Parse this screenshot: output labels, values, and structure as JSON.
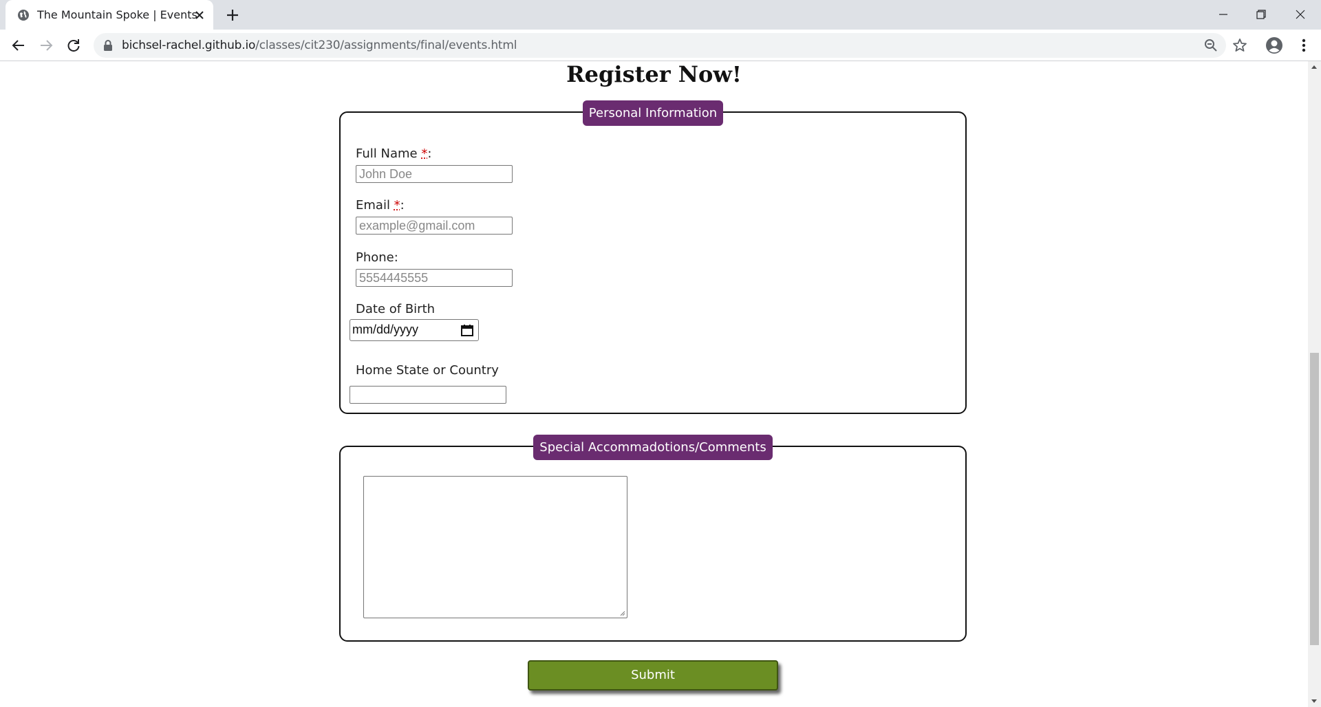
{
  "browser": {
    "tab_title": "The Mountain Spoke | Events",
    "url_host": "bichsel-rachel.github.io",
    "url_path": "/classes/cit230/assignments/final/events.html"
  },
  "page": {
    "heading": "Register Now!",
    "personal": {
      "legend": "Personal Information",
      "full_name_label": "Full Name ",
      "full_name_placeholder": "John Doe",
      "email_label": "Email ",
      "email_placeholder": "example@gmail.com",
      "phone_label": "Phone:",
      "phone_placeholder": "5554445555",
      "dob_label": "Date of Birth",
      "dob_value": "mm/dd/yyyy",
      "home_label": "Home State or Country",
      "required_mark": "*",
      "colon": ":"
    },
    "special": {
      "legend": "Special Accommadotions/Comments"
    },
    "submit_label": "Submit"
  },
  "colors": {
    "legend_bg": "#6a2c70",
    "submit_bg": "#6b8e23",
    "required": "#cc0000"
  },
  "icons": [
    "globe-icon",
    "close-icon",
    "plus-icon",
    "minimize-icon",
    "restore-icon",
    "window-close-icon",
    "back-icon",
    "forward-icon",
    "reload-icon",
    "lock-icon",
    "zoom-icon",
    "star-icon",
    "profile-icon",
    "menu-icon",
    "calendar-icon"
  ]
}
